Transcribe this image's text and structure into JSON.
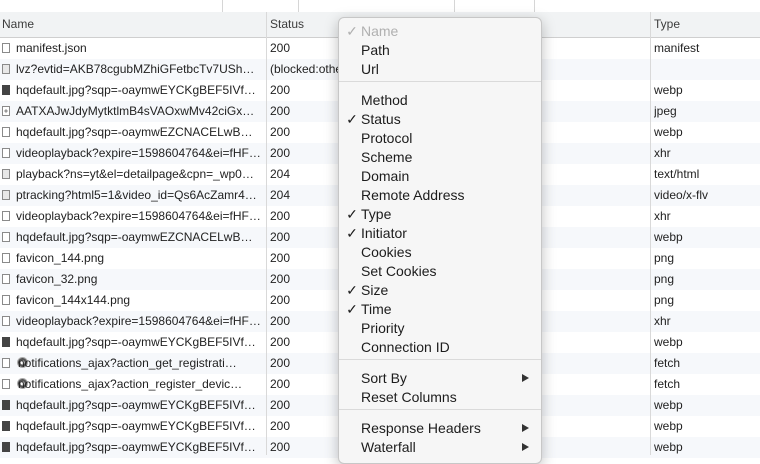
{
  "header": {
    "name": "Name",
    "status": "Status",
    "type": "Type"
  },
  "rows": [
    {
      "name": "manifest.json",
      "status": "200",
      "type": "manifest",
      "icon": "file-icon"
    },
    {
      "name": "lvz?evtid=AKB78cgubMZhiGFetbcTv7USh…",
      "status": "(blocked:othe",
      "type": "",
      "icon": "blocked-file-icon"
    },
    {
      "name": "hqdefault.jpg?sqp=-oaymwEYCKgBEF5IVf…",
      "status": "200",
      "type": "webp",
      "icon": "image-icon"
    },
    {
      "name": "AATXAJwJdyMytktlmB4sVAOxwMv42ciGx…",
      "status": "200",
      "type": "jpeg",
      "icon": "jpeg-icon"
    },
    {
      "name": "hqdefault.jpg?sqp=-oaymwEZCNACELwB…",
      "status": "200",
      "type": "webp",
      "icon": "file-icon"
    },
    {
      "name": "videoplayback?expire=1598604764&ei=fHF…",
      "status": "200",
      "type": "xhr",
      "icon": "file-icon"
    },
    {
      "name": "playback?ns=yt&el=detailpage&cpn=_wp0…",
      "status": "204",
      "type": "text/html",
      "icon": "blocked-file-icon"
    },
    {
      "name": "ptracking?html5=1&video_id=Qs6AcZamr4…",
      "status": "204",
      "type": "video/x-flv",
      "icon": "blocked-file-icon"
    },
    {
      "name": "videoplayback?expire=1598604764&ei=fHF…",
      "status": "200",
      "type": "xhr",
      "icon": "file-icon"
    },
    {
      "name": "hqdefault.jpg?sqp=-oaymwEZCNACELwB…",
      "status": "200",
      "type": "webp",
      "icon": "file-icon"
    },
    {
      "name": "favicon_144.png",
      "status": "200",
      "type": "png",
      "icon": "file-icon"
    },
    {
      "name": "favicon_32.png",
      "status": "200",
      "type": "png",
      "icon": "file-icon"
    },
    {
      "name": "favicon_144x144.png",
      "status": "200",
      "type": "png",
      "icon": "file-icon"
    },
    {
      "name": "videoplayback?expire=1598604764&ei=fHF…",
      "status": "200",
      "type": "xhr",
      "icon": "file-icon"
    },
    {
      "name": "hqdefault.jpg?sqp=-oaymwEYCKgBEF5IVf…",
      "status": "200",
      "type": "webp",
      "icon": "image-icon"
    },
    {
      "name": "notifications_ajax?action_get_registrati…",
      "status": "200",
      "type": "fetch",
      "icon": "gear-icon"
    },
    {
      "name": "notifications_ajax?action_register_devic…",
      "status": "200",
      "type": "fetch",
      "icon": "gear-icon"
    },
    {
      "name": "hqdefault.jpg?sqp=-oaymwEYCKgBEF5IVf…",
      "status": "200",
      "type": "webp",
      "icon": "image-icon"
    },
    {
      "name": "hqdefault.jpg?sqp=-oaymwEYCKgBEF5IVf…",
      "status": "200",
      "type": "webp",
      "icon": "image-icon"
    },
    {
      "name": "hqdefault.jpg?sqp=-oaymwEYCKgBEF5IVf…",
      "status": "200",
      "type": "webp",
      "icon": "image-icon"
    }
  ],
  "context_menu": {
    "checkmark": "✓",
    "items": [
      {
        "label": "Name",
        "checked": true,
        "disabled": true
      },
      {
        "label": "Path",
        "checked": false
      },
      {
        "label": "Url",
        "checked": false
      },
      {
        "label": "Method",
        "checked": false
      },
      {
        "label": "Status",
        "checked": true
      },
      {
        "label": "Protocol",
        "checked": false
      },
      {
        "label": "Scheme",
        "checked": false
      },
      {
        "label": "Domain",
        "checked": false
      },
      {
        "label": "Remote Address",
        "checked": false
      },
      {
        "label": "Type",
        "checked": true
      },
      {
        "label": "Initiator",
        "checked": true
      },
      {
        "label": "Cookies",
        "checked": false
      },
      {
        "label": "Set Cookies",
        "checked": false
      },
      {
        "label": "Size",
        "checked": true
      },
      {
        "label": "Time",
        "checked": true
      },
      {
        "label": "Priority",
        "checked": false
      },
      {
        "label": "Connection ID",
        "checked": false
      },
      {
        "label": "Sort By",
        "submenu": true
      },
      {
        "label": "Reset Columns"
      },
      {
        "label": "Response Headers",
        "submenu": true
      },
      {
        "label": "Waterfall",
        "submenu": true
      }
    ]
  }
}
